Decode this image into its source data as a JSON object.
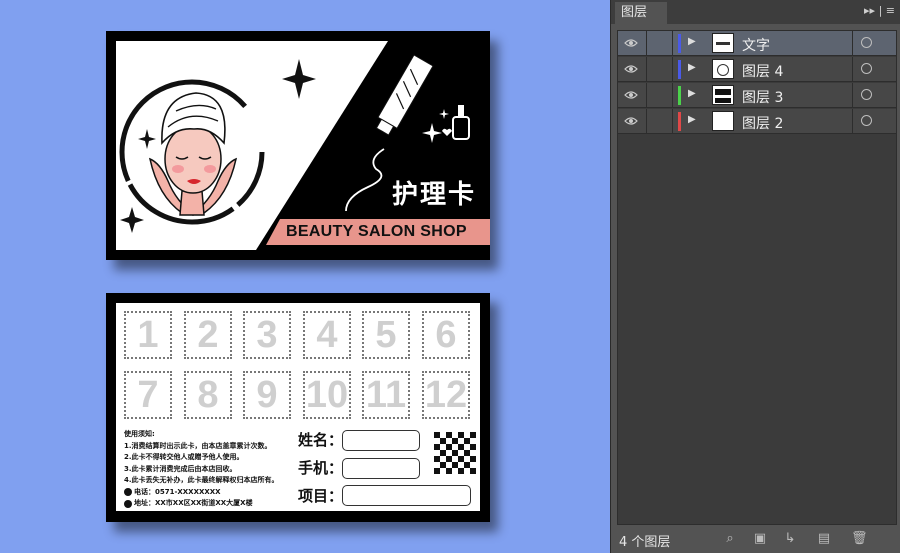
{
  "front_card": {
    "title": "护理卡",
    "banner": "BEAUTY SALON SHOP"
  },
  "back_card": {
    "stamps": [
      "1",
      "2",
      "3",
      "4",
      "5",
      "6",
      "7",
      "8",
      "9",
      "10",
      "11",
      "12"
    ],
    "notice_title": "使用须知:",
    "notice_lines": [
      "1.消费结算时出示此卡，由本店盖章累计次数。",
      "2.此卡不得转交他人或赠予他人使用。",
      "3.此卡累计消费完成后由本店回收。",
      "4.此卡丢失无补办，此卡最终解释权归本店所有。"
    ],
    "phone": "电话：0571-XXXXXXXX",
    "address": "地址：XX市XX区XX街道XX大厦X楼",
    "fields": {
      "name": "姓名：",
      "phone": "手机：",
      "item": "项目："
    }
  },
  "layers_panel": {
    "tab": "图层",
    "layers": [
      {
        "name": "文字",
        "color": "#4a5ae8",
        "selected": true
      },
      {
        "name": "图层 4",
        "color": "#4a5ae8",
        "selected": false
      },
      {
        "name": "图层 3",
        "color": "#4bd24b",
        "selected": false
      },
      {
        "name": "图层 2",
        "color": "#e04848",
        "selected": false
      }
    ],
    "footer_count": "4 个图层"
  }
}
